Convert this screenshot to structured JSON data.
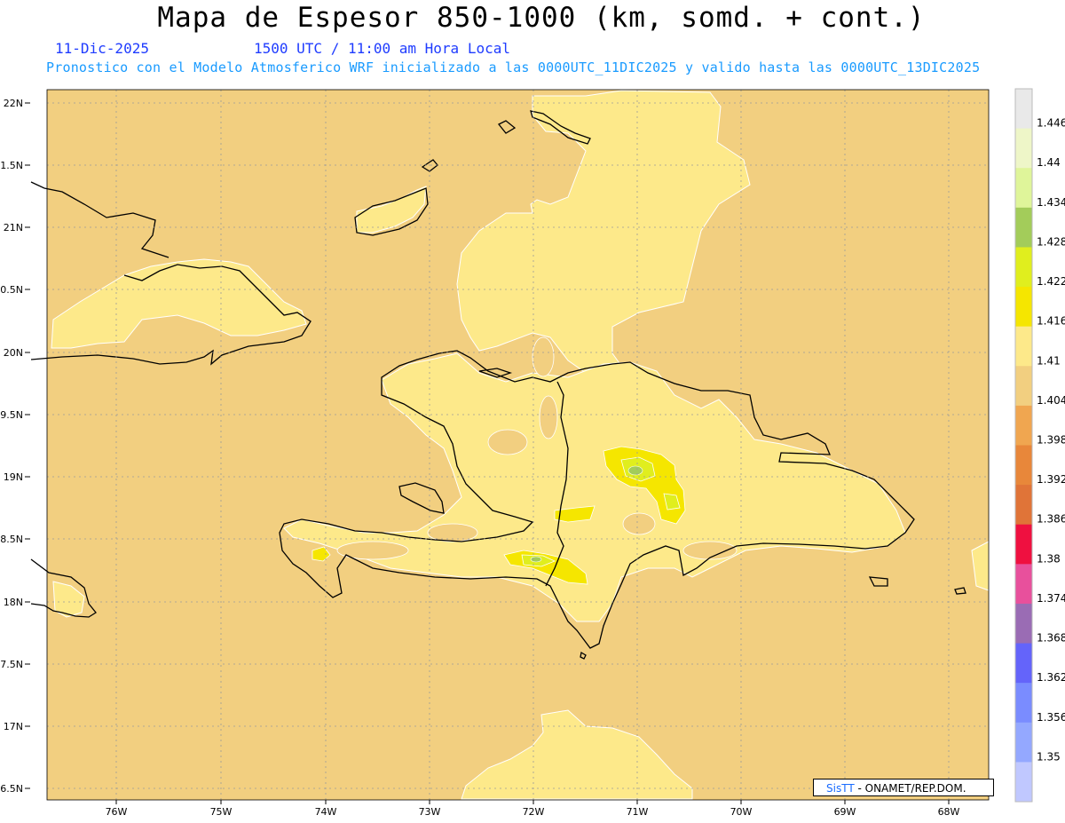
{
  "title": "Mapa de Espesor 850-1000 (km, somd. + cont.)",
  "date": "11-Dic-2025",
  "time": "1500 UTC / 11:00 am Hora Local",
  "model_info": "Pronostico con el Modelo Atmosferico WRF inicializado a las 0000UTC_11DIC2025 y valido hasta las  0000UTC_13DIC2025",
  "credit": {
    "brand": "SisTT",
    "text": "- ONAMET/REP.DOM."
  },
  "map": {
    "lat_labels": [
      "22N",
      "1.5N",
      "21N",
      "0.5N",
      "20N",
      "9.5N",
      "19N",
      "8.5N",
      "18N",
      "7.5N",
      "17N",
      "6.5N"
    ],
    "lon_labels": [
      "76W",
      "75W",
      "74W",
      "73W",
      "72W",
      "71W",
      "70W",
      "69W",
      "68W"
    ],
    "colors": {
      "background": "#f2cf80",
      "c_1410": "#fde98a",
      "c_1416": "#f5e600",
      "c_1422": "#e0ee1e",
      "c_1428": "#a2cc5a",
      "coast": "#000000",
      "grid": "#9a9a9a"
    }
  },
  "colorbar": {
    "labels": [
      "1.446",
      "1.44",
      "1.434",
      "1.428",
      "1.422",
      "1.416",
      "1.41",
      "1.404",
      "1.398",
      "1.392",
      "1.386",
      "1.38",
      "1.374",
      "1.368",
      "1.362",
      "1.356",
      "1.35"
    ],
    "colors": [
      "#e9e9e9",
      "#eef6c8",
      "#dff59a",
      "#a3cc5a",
      "#e0ee1e",
      "#f5e600",
      "#fde98a",
      "#f2cf80",
      "#f0a650",
      "#e8873a",
      "#e07438",
      "#ef1040",
      "#e8509c",
      "#9a6cb4",
      "#6464fa",
      "#7a8cff",
      "#94a8ff",
      "#c0c8ff"
    ]
  }
}
